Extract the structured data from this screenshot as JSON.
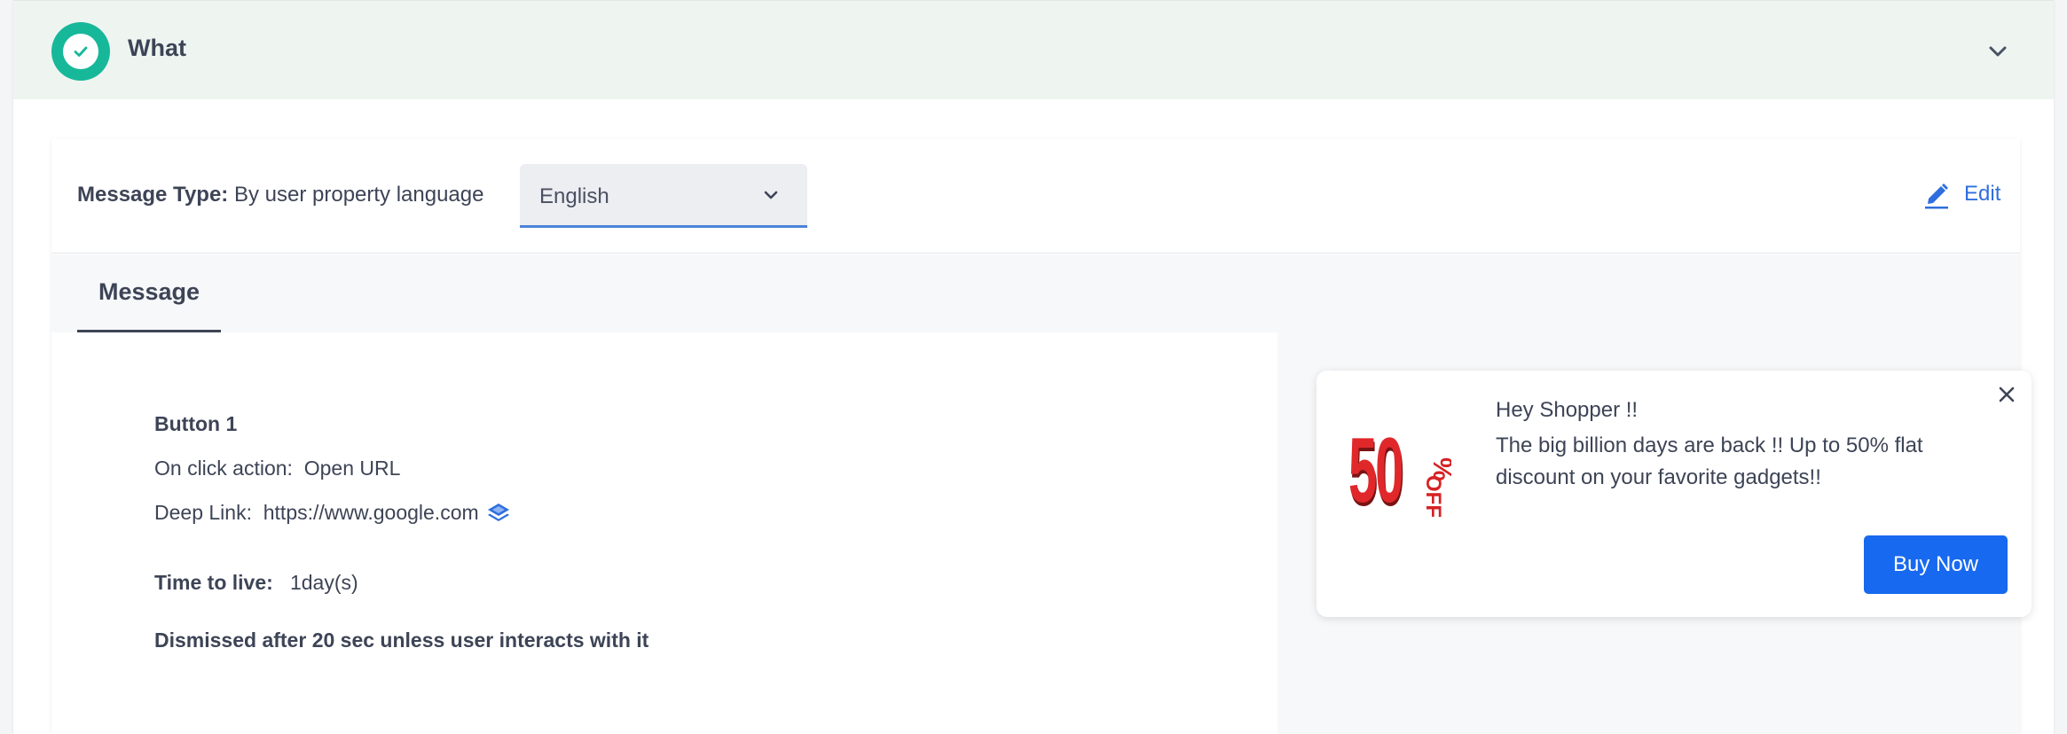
{
  "section": {
    "title": "What",
    "status_icon": "check-circle-icon",
    "collapse_icon": "chevron-down-icon"
  },
  "message_type": {
    "label": "Message Type:",
    "value": "By user property language",
    "language": "English",
    "edit_label": "Edit"
  },
  "tabs": [
    {
      "label": "Message",
      "active": true
    }
  ],
  "details": {
    "button_name": "Button 1",
    "on_click_label": "On click action:",
    "on_click_value": "Open URL",
    "deep_link_label": "Deep Link:",
    "deep_link_value": "https://www.google.com",
    "ttl_label": "Time to live:",
    "ttl_value": "1day(s)",
    "dismiss_text": "Dismissed after 20 sec unless user interacts with it"
  },
  "preview": {
    "image_text": "50% OFF",
    "title": "Hey Shopper !!",
    "body": "The big billion days are back !! Up to 50% flat discount on your favorite gadgets!!",
    "button_label": "Buy Now"
  },
  "colors": {
    "accent": "#1769ef",
    "success": "#17b89a",
    "link": "#2f6fdd",
    "header_bg": "#eef5f1"
  }
}
